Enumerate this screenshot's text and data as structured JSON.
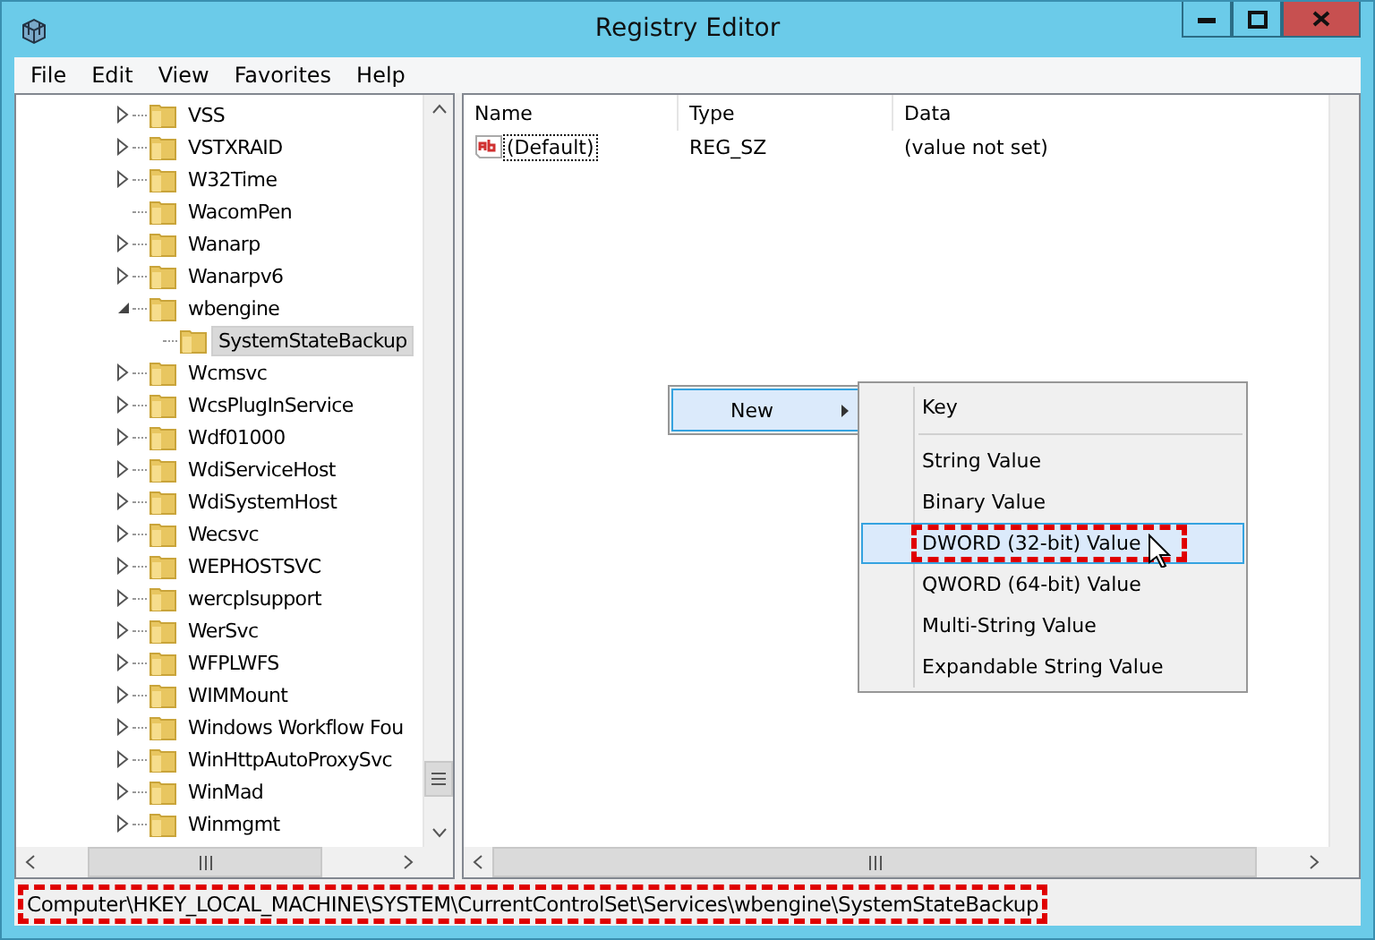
{
  "window": {
    "title": "Registry Editor"
  },
  "menu": [
    "File",
    "Edit",
    "View",
    "Favorites",
    "Help"
  ],
  "tree": [
    {
      "label": "VSS",
      "kind": "collapsed"
    },
    {
      "label": "VSTXRAID",
      "kind": "collapsed"
    },
    {
      "label": "W32Time",
      "kind": "collapsed"
    },
    {
      "label": "WacomPen",
      "kind": "leaf"
    },
    {
      "label": "Wanarp",
      "kind": "collapsed"
    },
    {
      "label": "Wanarpv6",
      "kind": "collapsed"
    },
    {
      "label": "wbengine",
      "kind": "expanded",
      "children": [
        {
          "label": "SystemStateBackup",
          "kind": "leaf",
          "selected": true
        }
      ]
    },
    {
      "label": "Wcmsvc",
      "kind": "collapsed"
    },
    {
      "label": "WcsPlugInService",
      "kind": "collapsed"
    },
    {
      "label": "Wdf01000",
      "kind": "collapsed"
    },
    {
      "label": "WdiServiceHost",
      "kind": "collapsed"
    },
    {
      "label": "WdiSystemHost",
      "kind": "collapsed"
    },
    {
      "label": "Wecsvc",
      "kind": "collapsed"
    },
    {
      "label": "WEPHOSTSVC",
      "kind": "collapsed"
    },
    {
      "label": "wercplsupport",
      "kind": "collapsed"
    },
    {
      "label": "WerSvc",
      "kind": "collapsed"
    },
    {
      "label": "WFPLWFS",
      "kind": "collapsed"
    },
    {
      "label": "WIMMount",
      "kind": "collapsed"
    },
    {
      "label": "Windows Workflow Fou",
      "kind": "collapsed"
    },
    {
      "label": "WinHttpAutoProxySvc",
      "kind": "collapsed"
    },
    {
      "label": "WinMad",
      "kind": "collapsed"
    },
    {
      "label": "Winmgmt",
      "kind": "collapsed"
    }
  ],
  "table": {
    "columns": [
      "Name",
      "Type",
      "Data"
    ],
    "rows": [
      {
        "name": "(Default)",
        "type": "REG_SZ",
        "data": "(value not set)",
        "focused": true
      }
    ]
  },
  "context_menu": {
    "items": [
      {
        "label": "New",
        "selected": true
      }
    ],
    "submenu": [
      {
        "label": "Key",
        "kind": "item",
        "selected": false
      },
      {
        "kind": "separator"
      },
      {
        "label": "String Value",
        "kind": "item",
        "selected": false
      },
      {
        "label": "Binary Value",
        "kind": "item",
        "selected": false
      },
      {
        "label": "DWORD (32-bit) Value",
        "kind": "item",
        "selected": true,
        "highlight": true
      },
      {
        "label": "QWORD (64-bit) Value",
        "kind": "item",
        "selected": false
      },
      {
        "label": "Multi-String Value",
        "kind": "item",
        "selected": false
      },
      {
        "label": "Expandable String Value",
        "kind": "item",
        "selected": false
      }
    ]
  },
  "status_bar": {
    "path": "Computer\\HKEY_LOCAL_MACHINE\\SYSTEM\\CurrentControlSet\\Services\\wbengine\\SystemStateBackup",
    "highlight": true
  }
}
